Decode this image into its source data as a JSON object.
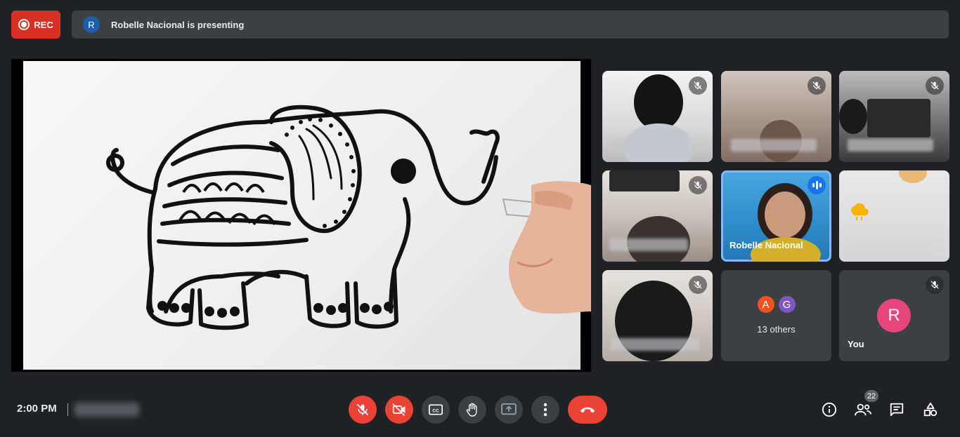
{
  "record": {
    "label": "REC"
  },
  "presenting": {
    "avatar_letter": "R",
    "text": "Robelle Nacional is presenting"
  },
  "tiles": {
    "speaker": {
      "name": "Robelle Nacional"
    },
    "others": {
      "letters": [
        "A",
        "G"
      ],
      "colors": [
        "#f4511e",
        "#7e57c2"
      ],
      "label": "13 others"
    },
    "self": {
      "avatar_letter": "R",
      "name": "You"
    }
  },
  "footer": {
    "time": "2:00 PM"
  },
  "controls": {
    "people_count": "22",
    "accent_red": "#ea4335",
    "speaking_blue": "#1a73e8"
  }
}
